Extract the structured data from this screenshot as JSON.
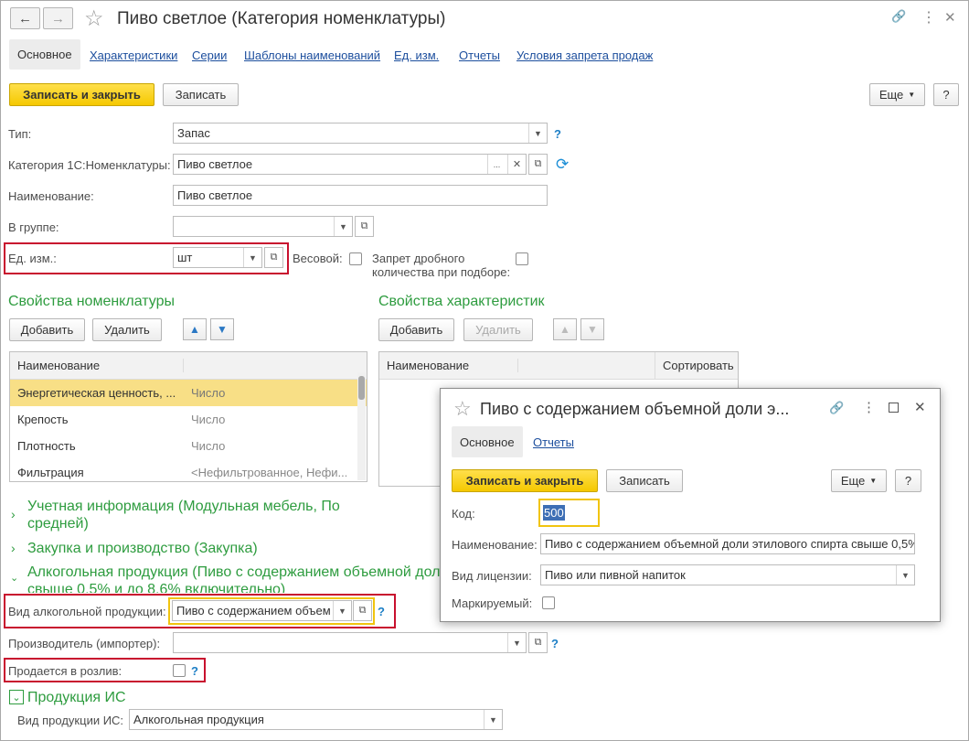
{
  "window": {
    "title": "Пиво светлое (Категория номенклатуры)",
    "back": "←",
    "forward": "→",
    "star": "☆",
    "link_icon": "🔗",
    "more_icon": "⋮",
    "close_icon": "✕"
  },
  "tabs": [
    {
      "label": "Основное",
      "active": true
    },
    {
      "label": "Характеристики"
    },
    {
      "label": "Серии"
    },
    {
      "label": "Шаблоны наименований"
    },
    {
      "label": "Ед. изм."
    },
    {
      "label": "Отчеты"
    },
    {
      "label": "Условия запрета продаж"
    }
  ],
  "toolbar": {
    "save_close": "Записать и закрыть",
    "save": "Записать",
    "more": "Еще",
    "help": "?"
  },
  "form": {
    "type_label": "Тип:",
    "type_value": "Запас",
    "category_label": "Категория 1С:Номенклатуры:",
    "category_value": "Пиво светлое",
    "name_label": "Наименование:",
    "name_value": "Пиво светлое",
    "group_label": "В группе:",
    "group_value": "",
    "unit_label": "Ед. изм.:",
    "unit_value": "шт",
    "weight_label": "Весовой:",
    "ban_label_1": "Запрет дробного",
    "ban_label_2": "количества при подборе:",
    "q": "?"
  },
  "props": {
    "title": "Свойства номенклатуры",
    "add": "Добавить",
    "delete": "Удалить",
    "col_name": "Наименование",
    "rows": [
      {
        "name": "Энергетическая ценность, ...",
        "type": "Число",
        "selected": true
      },
      {
        "name": "Крепость",
        "type": "Число"
      },
      {
        "name": "Плотность",
        "type": "Число"
      },
      {
        "name": "Фильтрация",
        "type": "<Нефильтрованное, Нефи..."
      }
    ]
  },
  "char_props": {
    "title": "Свойства характеристик",
    "add": "Добавить",
    "delete": "Удалить",
    "col_name": "Наименование",
    "col_sort": "Сортировать"
  },
  "sections": {
    "accounting_1": "Учетная информация (Модульная мебель, По",
    "accounting_2": "средней)",
    "purchase": "Закупка и производство (Закупка)",
    "alcohol_1": "Алкогольная продукция (Пиво с содержанием объемной доли",
    "alcohol_2": "свыше 0,5% и до 8,6% включительно)",
    "is_title": "Продукция ИС"
  },
  "alcohol": {
    "kind_label": "Вид алкогольной продукции:",
    "kind_value": "Пиво с содержанием объем",
    "producer_label": "Производитель (импортер):",
    "producer_value": "",
    "draft_label": "Продается в розлив:",
    "q": "?"
  },
  "is": {
    "kind_label": "Вид продукции ИС:",
    "kind_value": "Алкогольная продукция"
  },
  "popup": {
    "title": "Пиво с содержанием объемной доли э...",
    "tab": "Основное",
    "tab2": "Отчеты",
    "save_close": "Записать и закрыть",
    "save": "Записать",
    "more": "Еще",
    "help": "?",
    "code_label": "Код:",
    "code_value": "500",
    "name_label": "Наименование:",
    "name_value": "Пиво с содержанием объемной доли этилового спирта свыше 0,5%",
    "license_label": "Вид лицензии:",
    "license_value": "Пиво или пивной напиток",
    "marked_label": "Маркируемый:"
  }
}
